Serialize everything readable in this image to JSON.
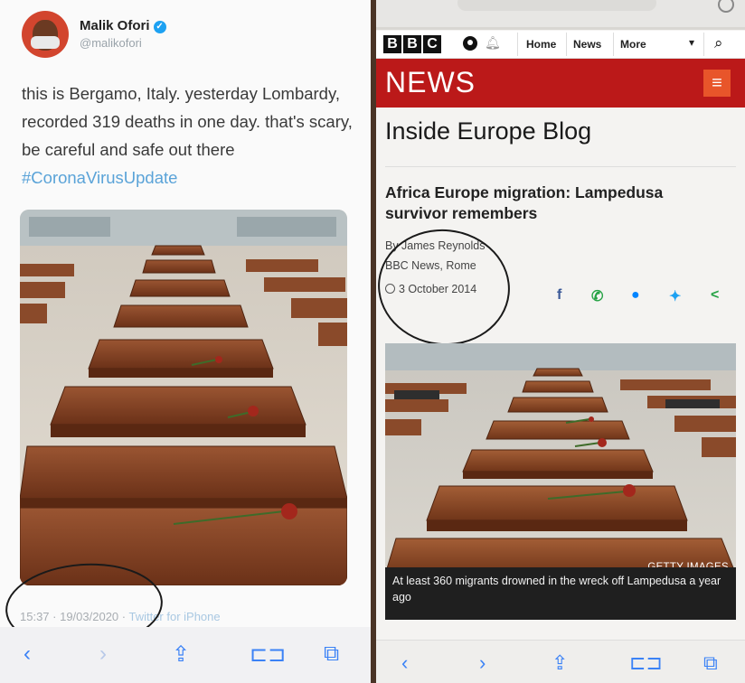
{
  "tweet": {
    "author_name": "Malik Ofori",
    "handle": "@malikofori",
    "text": "this is Bergamo, Italy. yesterday Lombardy, recorded 319 deaths in one day. that's scary, be careful and safe out there ",
    "hashtag": "#CoronaVirusUpdate",
    "timestamp": "15:37 · 19/03/2020 · ",
    "client": "Twitter for iPhone",
    "photo_subject": "coffins"
  },
  "left_toolbar": {
    "back_icon": "back-chevron-icon",
    "forward_icon": "forward-chevron-icon",
    "share_icon": "share-icon",
    "bookmarks_icon": "book-icon",
    "tabs_icon": "tabs-icon"
  },
  "bbc": {
    "logo_letters": [
      "B",
      "B",
      "C"
    ],
    "nav": [
      "Home",
      "News",
      "More"
    ],
    "section": "NEWS",
    "blog_title": "Inside Europe Blog",
    "headline": "Africa Europe migration: Lampedusa survivor remembers",
    "byline_author": "By James Reynolds",
    "byline_place": "BBC News, Rome",
    "date": "3 October 2014",
    "share_icons": [
      "facebook-icon",
      "whatsapp-icon",
      "messenger-icon",
      "twitter-icon",
      "share-icon"
    ],
    "photo_credit": "GETTY IMAGES",
    "caption": "At least 360 migrants drowned in the wreck off Lampedusa a year ago"
  },
  "colors": {
    "bbc_red": "#bb1919",
    "twitter_blue": "#1da1f2",
    "ios_blue": "#3b82f6",
    "coffin_brown": "#7a3e22"
  }
}
